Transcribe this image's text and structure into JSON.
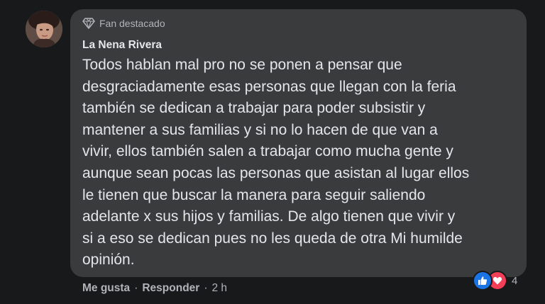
{
  "comment": {
    "badge": "Fan destacado",
    "badge_icon": "diamond-icon",
    "author": "La Nena Rivera",
    "text": "Todos hablan mal pro no se ponen a pensar que\ndesgraciadamente esas personas que llegan con la feria\ntambién se dedican a trabajar para poder subsistir y\nmantener a sus familias y si no lo hacen de que van a\nvivir, ellos también salen a trabajar como mucha gente y\naunque sean pocas las personas que asistan al lugar ellos\nle tienen que buscar la manera para seguir saliendo\nadelante x sus hijos y familias. De algo tienen que vivir y\nsi a eso se dedican pues no les queda de otra Mi humilde\nopinión."
  },
  "actions": {
    "like": "Me gusta",
    "separator": "·",
    "reply": "Responder",
    "time": "2 h"
  },
  "reactions": {
    "icons": [
      "like-icon",
      "love-icon"
    ],
    "count": "4"
  },
  "colors": {
    "background": "#18191a",
    "bubble": "#3a3b3c",
    "text_primary": "#e4e6eb",
    "text_secondary": "#b0b3b8",
    "like_blue": "#1b74e4",
    "love_red": "#f33e58"
  }
}
